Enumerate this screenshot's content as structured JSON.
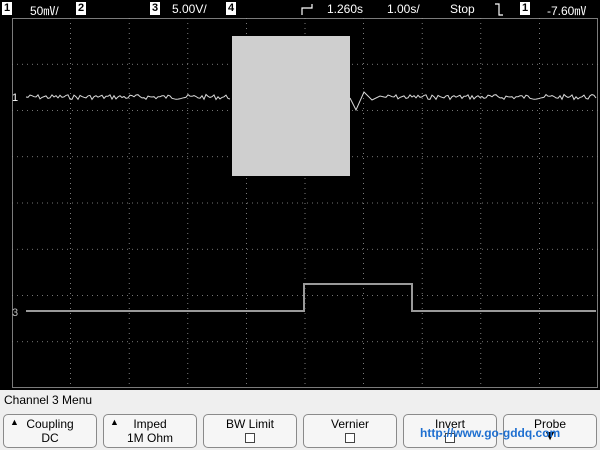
{
  "status": {
    "ch1_num": "1",
    "ch1_scale": "50㎷/",
    "ch2_num": "2",
    "ch3_num": "3",
    "ch3_scale": "5.00V/",
    "ch4_num": "4",
    "trigger_pos_icon": "trigger-position-icon",
    "time_delay": "1.260s",
    "time_scale": "1.00s/",
    "run_state": "Stop",
    "trigger_edge_icon": "falling-edge-icon",
    "trig_ch_num": "1",
    "trig_level": "-7.60㎷"
  },
  "screen": {
    "ch1_marker": "1",
    "ch3_marker": "3",
    "trace_color": "#d9d9d9",
    "ch3_color": "#9a9a9a",
    "grid_color": "#9a9a9a"
  },
  "menu": {
    "title": "Channel 3  Menu",
    "softkeys": [
      {
        "line1": "Coupling",
        "line2": "DC"
      },
      {
        "line1": "Imped",
        "line2": "1M Ohm"
      },
      {
        "line1": "BW Limit"
      },
      {
        "line1": "Vernier"
      },
      {
        "line1": "Invert"
      },
      {
        "line1": "Probe"
      }
    ]
  },
  "watermark": "http://www.go-gddq.com"
}
